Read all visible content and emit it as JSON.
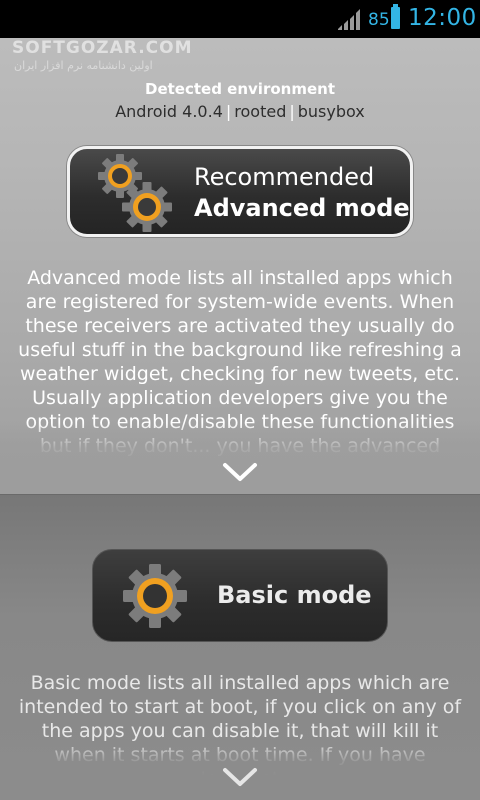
{
  "status_bar": {
    "battery_level": "85",
    "time": "12:00",
    "accent_color": "#33b5e5",
    "icons": [
      "signal-icon",
      "battery-icon"
    ]
  },
  "watermark": {
    "text": "SOFTGOZAR.COM",
    "subtext": "اولین دانشنامه نرم افزار ایران"
  },
  "environment": {
    "label": "Detected environment",
    "android_version": "Android 4.0.4",
    "root_status": "rooted",
    "busybox": "busybox",
    "separator": "|"
  },
  "advanced_mode": {
    "line1": "Recommended",
    "line2": "Advanced mode",
    "icon": "gears-icon",
    "description": "Advanced mode lists all installed apps which are registered for system-wide events. When these receivers are activated they usually do useful stuff in the background like refreshing a weather widget, checking for new tweets, etc. Usually application developers give you the option to enable/disable these functionalities but if they don't... you have the advanced mode",
    "expand_icon": "chevron-down-icon"
  },
  "basic_mode": {
    "label": "Basic mode",
    "icon": "gear-icon",
    "description": "Basic mode lists all installed apps which are intended to start at boot, if you click on any of the apps you can disable it, that will kill it when it starts at boot time. If you have 'prevent",
    "expand_icon": "chevron-down-icon"
  },
  "colors": {
    "gear_orange": "#f0a020",
    "button_dark": "#2d2d2d"
  }
}
